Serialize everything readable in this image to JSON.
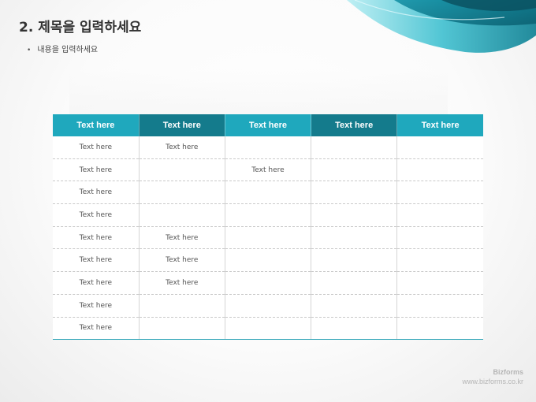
{
  "slide": {
    "title": "2. 제목을 입력하세요",
    "bullet": "내용을 입력하세요",
    "bullet_symbol": "•"
  },
  "colors": {
    "header_light": "#1fa8bd",
    "header_dark": "#147b8c",
    "accent_line": "#2aa3b6",
    "wave_light": "#8be0ea",
    "wave_dark": "#0b7f92"
  },
  "table": {
    "headers": [
      "Text here",
      "Text here",
      "Text here",
      "Text here",
      "Text here"
    ],
    "rows": [
      [
        "Text here",
        "Text here",
        "",
        "",
        ""
      ],
      [
        "Text here",
        "",
        "Text here",
        "",
        ""
      ],
      [
        "Text here",
        "",
        "",
        "",
        ""
      ],
      [
        "Text here",
        "",
        "",
        "",
        ""
      ],
      [
        "Text here",
        "Text here",
        "",
        "",
        ""
      ],
      [
        "Text here",
        "Text here",
        "",
        "",
        ""
      ],
      [
        "Text here",
        "Text here",
        "",
        "",
        ""
      ],
      [
        "Text here",
        "",
        "",
        "",
        ""
      ],
      [
        "Text here",
        "",
        "",
        "",
        ""
      ]
    ]
  },
  "brand": {
    "name": "Bizforms",
    "url": "www.bizforms.co.kr"
  }
}
